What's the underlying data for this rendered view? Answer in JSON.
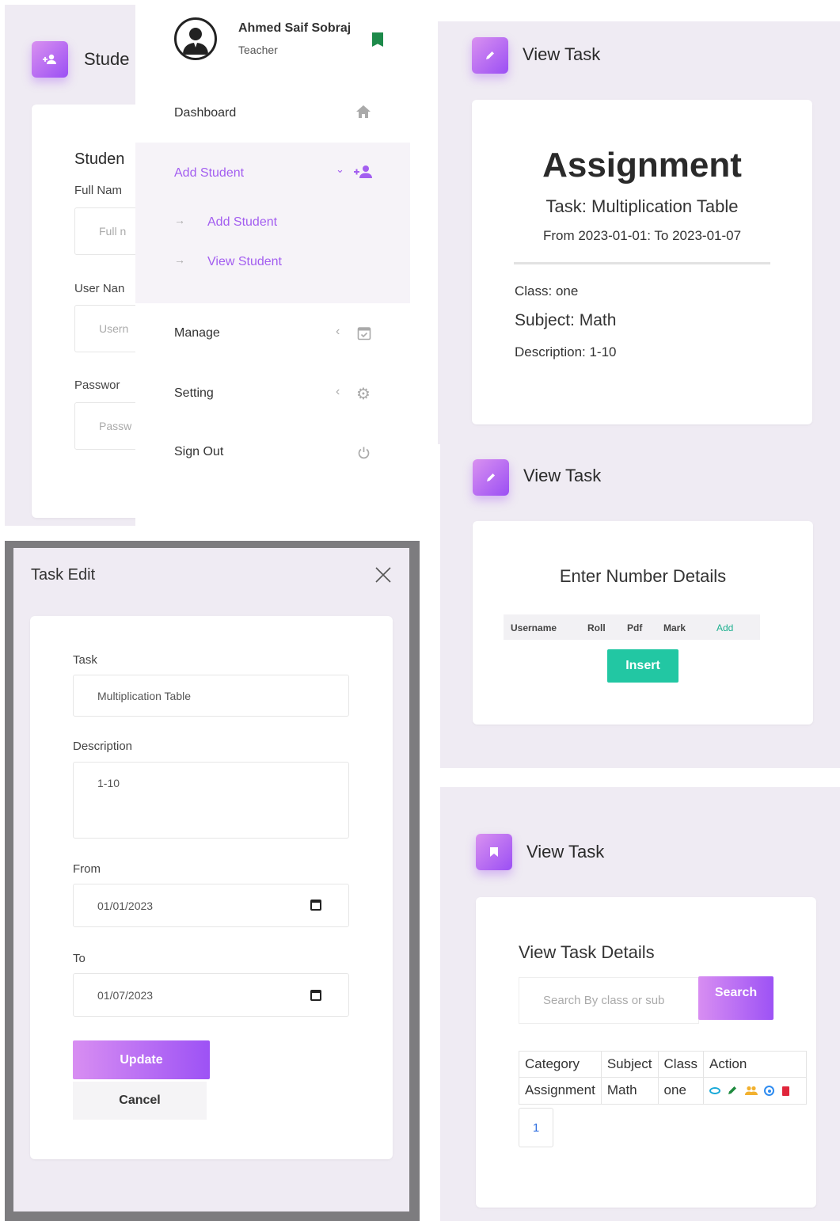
{
  "panel1": {
    "header_title": "Stude",
    "form_title": "Studen",
    "full_name_label": "Full Nam",
    "full_name_placeholder": "Full n",
    "user_name_label": "User Nan",
    "user_name_placeholder": "Usern",
    "password_label": "Passwor",
    "password_placeholder": "Passw",
    "sidebar": {
      "user_name": "Ahmed Saif Sobraj",
      "user_role": "Teacher",
      "dashboard": "Dashboard",
      "add_student": "Add Student",
      "sub_add_student": "Add Student",
      "sub_view_student": "View Student",
      "manage": "Manage",
      "setting": "Setting",
      "sign_out": "Sign Out"
    }
  },
  "panel2": {
    "header_title": "View Task",
    "heading": "Assignment",
    "task": "Task: Multiplication Table",
    "dates": "From 2023-01-01: To 2023-01-07",
    "class": "Class: one",
    "subject": "Subject: Math",
    "description": "Description: 1-10"
  },
  "panel3": {
    "title": "Task Edit",
    "task_label": "Task",
    "task_value": "Multiplication Table",
    "description_label": "Description",
    "description_value": "1-10",
    "from_label": "From",
    "from_value": "01/01/2023",
    "to_label": "To",
    "to_value": "01/07/2023",
    "update_label": "Update",
    "cancel_label": "Cancel"
  },
  "panel4": {
    "header_title": "View Task",
    "heading": "Enter Number Details",
    "columns": [
      "Username",
      "Roll",
      "Pdf",
      "Mark",
      "Add"
    ],
    "insert_label": "Insert"
  },
  "panel5": {
    "header_title": "View Task",
    "heading": "View Task Details",
    "search_placeholder": "Search By class or sub",
    "search_label": "Search",
    "table_headers": [
      "Category",
      "Subject",
      "Class",
      "Action"
    ],
    "table_row": [
      "Assignment",
      "Math",
      "one"
    ],
    "page_number": "1"
  },
  "colors": {
    "accent_gradient_start": "#d88ef2",
    "accent_gradient_end": "#9d52f5",
    "active_menu": "#a35ef0",
    "insert_button": "#22c7a3",
    "pane_background": "#efebf3"
  },
  "icons": [
    "user-plus-icon",
    "avatar-icon",
    "verified-badge-icon",
    "home-icon",
    "chevron-down-icon",
    "arrow-right-icon",
    "chevron-left-icon",
    "calendar-check-icon",
    "gear-icon",
    "power-icon",
    "pencil-icon",
    "close-icon",
    "calendar-icon",
    "bookmark-icon",
    "eye-icon",
    "users-icon",
    "plus-circle-icon",
    "trash-icon"
  ]
}
